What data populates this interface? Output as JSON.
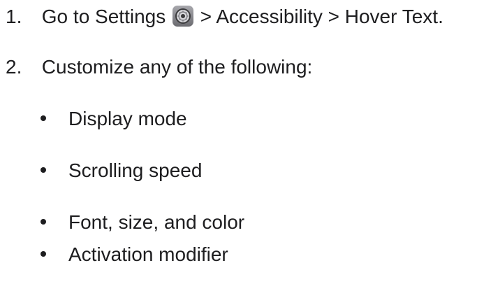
{
  "steps": [
    {
      "number": "1.",
      "text_before_icon": "Go to Settings",
      "icon": "settings-gear-icon",
      "text_after_icon": "> Accessibility > Hover Text."
    },
    {
      "number": "2.",
      "text": "Customize any of the following:"
    }
  ],
  "options": [
    "Display mode",
    "Scrolling speed",
    "Font, size, and color",
    "Activation modifier"
  ]
}
